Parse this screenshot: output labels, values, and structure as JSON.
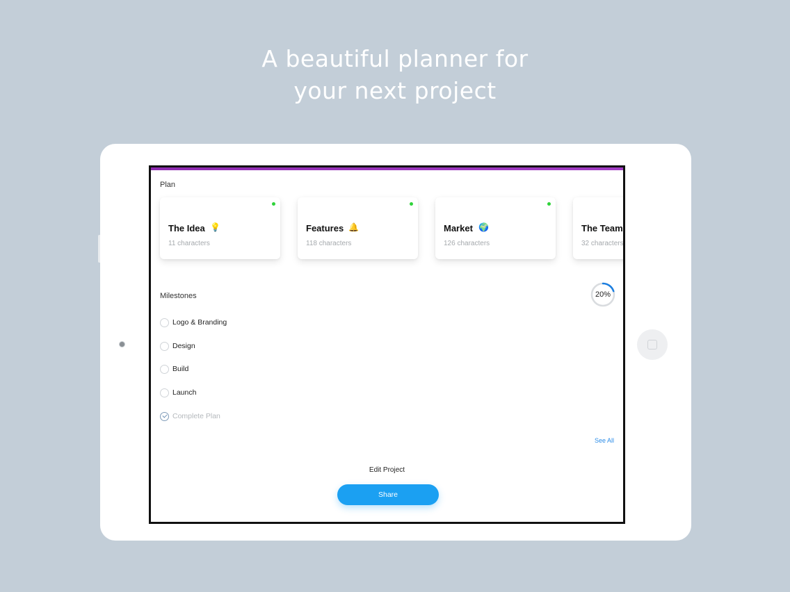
{
  "headline": {
    "line1": "A beautiful planner for",
    "line2": "your next project"
  },
  "colors": {
    "background": "#c3ced8",
    "accent_bar": "#9b35bf",
    "status_dot": "#2fd33a",
    "primary": "#1ba0f2",
    "link": "#2d8de8"
  },
  "plan": {
    "label": "Plan",
    "cards": [
      {
        "title": "The Idea",
        "emoji": "💡",
        "subtitle": "11 characters",
        "status": "green"
      },
      {
        "title": "Features",
        "emoji": "🔔",
        "subtitle": "118 characters",
        "status": "green"
      },
      {
        "title": "Market",
        "emoji": "🌍",
        "subtitle": "126 characters",
        "status": "green"
      },
      {
        "title": "The Team",
        "emoji": "",
        "subtitle": "32 characters",
        "status": ""
      }
    ]
  },
  "milestones": {
    "label": "Milestones",
    "progress_text": "20%",
    "progress_fraction": 0.2,
    "items": [
      {
        "label": "Logo & Branding",
        "done": false
      },
      {
        "label": "Design",
        "done": false
      },
      {
        "label": "Build",
        "done": false
      },
      {
        "label": "Launch",
        "done": false
      },
      {
        "label": "Complete Plan",
        "done": true
      }
    ],
    "see_all": "See All"
  },
  "actions": {
    "edit_project": "Edit Project",
    "share": "Share"
  },
  "icons": {
    "home_button": "home-square-icon",
    "check": "checkmark-icon",
    "lightbulb": "lightbulb-icon",
    "bell": "bell-icon",
    "globe": "globe-icon"
  }
}
